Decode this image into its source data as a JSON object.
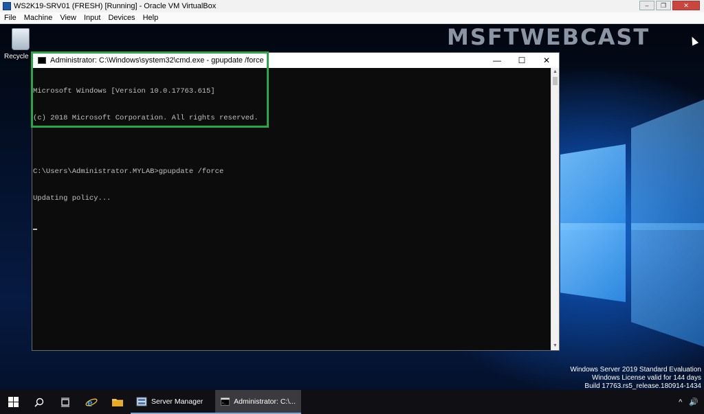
{
  "host": {
    "title": "WS2K19-SRV01 (FRESH) [Running] - Oracle VM VirtualBox",
    "menu": [
      "File",
      "Machine",
      "View",
      "Input",
      "Devices",
      "Help"
    ],
    "window_buttons": [
      "–",
      "❐",
      "✕"
    ]
  },
  "desktop": {
    "recycle_bin_label": "Recycle Bin",
    "watermark": "MSFTWEBCAST",
    "evaluation": [
      "Windows Server 2019 Standard Evaluation",
      "Windows License valid for 144 days",
      "Build 17763.rs5_release.180914-1434"
    ]
  },
  "cmd": {
    "title": "Administrator: C:\\Windows\\system32\\cmd.exe - gpupdate  /force",
    "controls": [
      "—",
      "☐",
      "✕"
    ],
    "lines": [
      "Microsoft Windows [Version 10.0.17763.615]",
      "(c) 2018 Microsoft Corporation. All rights reserved.",
      "",
      "C:\\Users\\Administrator.MYLAB>gpupdate /force",
      "Updating policy..."
    ],
    "highlight_color": "#29a64a"
  },
  "taskbar": {
    "server_manager_label": "Server Manager",
    "cmd_label": "Administrator: C:\\...",
    "tray_chevron": "^",
    "tray_speaker": "🔊",
    "icons": [
      "windows-start",
      "search",
      "task-view",
      "internet-explorer",
      "file-explorer"
    ]
  }
}
